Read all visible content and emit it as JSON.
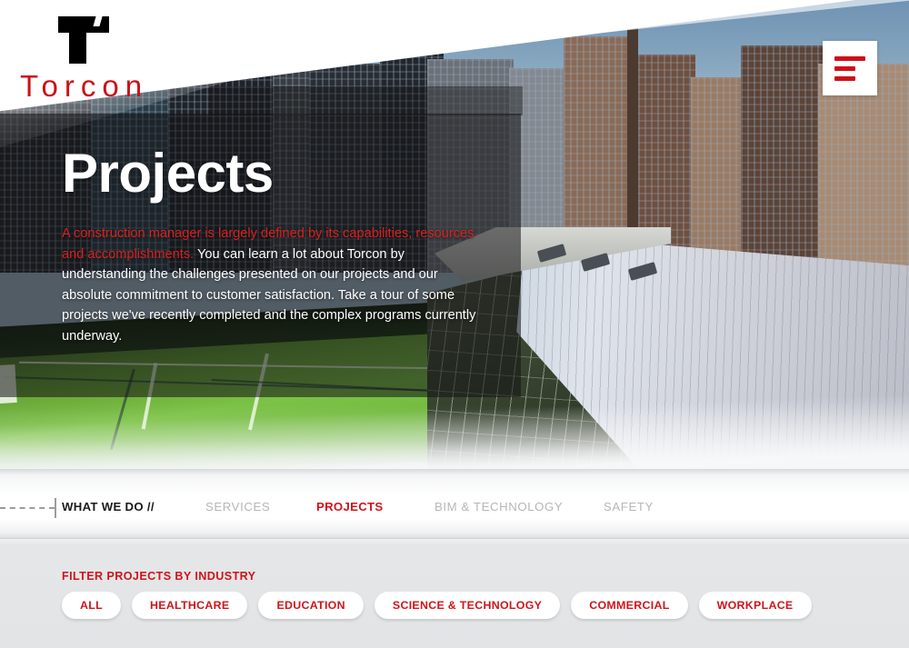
{
  "brand": {
    "name": "Torcon",
    "logo_mark": "torcon-t-mark",
    "logo_color": "#cc1118"
  },
  "header": {
    "menu_icon": "hamburger-menu-icon"
  },
  "hero": {
    "title": "Projects",
    "lead_text": "A construction manager is largely defined by its capabilities, resources and accomplishments.",
    "body_text": " You can learn a lot about Torcon by understanding the challenges presented on our projects and our absolute commitment to customer satisfaction. Take a tour of some projects we've recently completed and the complex programs currently underway.",
    "lead_color": "#d9211f"
  },
  "nav": {
    "section_label": "WHAT WE DO //",
    "items": [
      {
        "label": "SERVICES",
        "active": false
      },
      {
        "label": "PROJECTS",
        "active": true
      },
      {
        "label": "BIM & TECHNOLOGY",
        "active": false
      },
      {
        "label": "SAFETY",
        "active": false
      }
    ]
  },
  "filters": {
    "title": "FILTER PROJECTS BY INDUSTRY",
    "options": [
      {
        "label": "ALL"
      },
      {
        "label": "HEALTHCARE"
      },
      {
        "label": "EDUCATION"
      },
      {
        "label": "SCIENCE & TECHNOLOGY"
      },
      {
        "label": "COMMERCIAL"
      },
      {
        "label": "WORKPLACE"
      }
    ],
    "accent_color": "#d0141a"
  }
}
